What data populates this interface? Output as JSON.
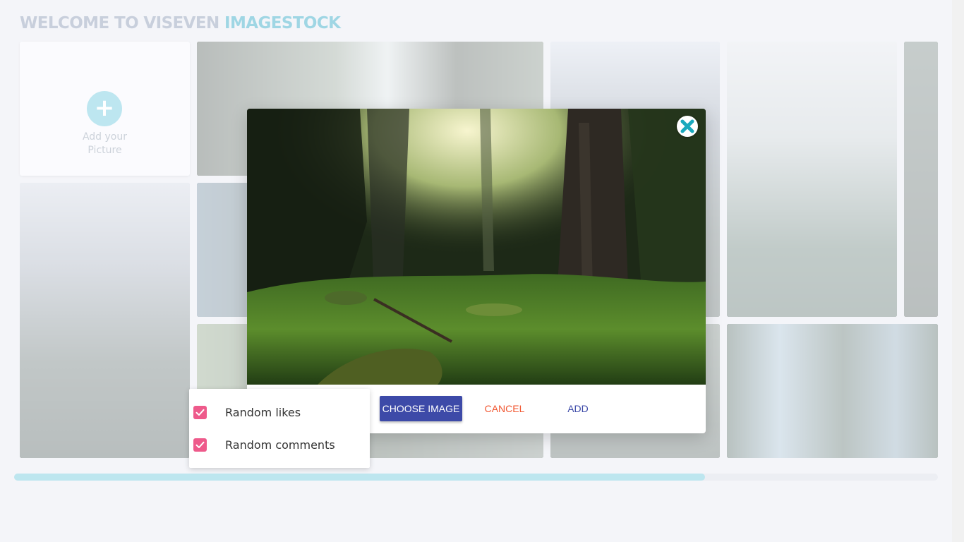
{
  "header": {
    "title_prefix": "WELCOME TO VISEVEN ",
    "title_accent": "IMAGESTOCK"
  },
  "add_tile": {
    "line1": "Add your",
    "line2": "Picture",
    "icon": "plus-icon"
  },
  "modal": {
    "image_desc_icon": "forest-photo",
    "close_icon": "close-icon",
    "buttons": {
      "choose": "CHOOSE IMAGE",
      "cancel": "CANCEL",
      "add": "ADD"
    }
  },
  "options": [
    {
      "label": "Random likes",
      "checked": true
    },
    {
      "label": "Random comments",
      "checked": true
    }
  ],
  "progress": {
    "fraction": 0.748
  },
  "colors": {
    "accent": "#3d4aa8",
    "danger": "#f1552f",
    "checkbox": "#ee5a8b",
    "brand_light": "#9fd6e4"
  }
}
